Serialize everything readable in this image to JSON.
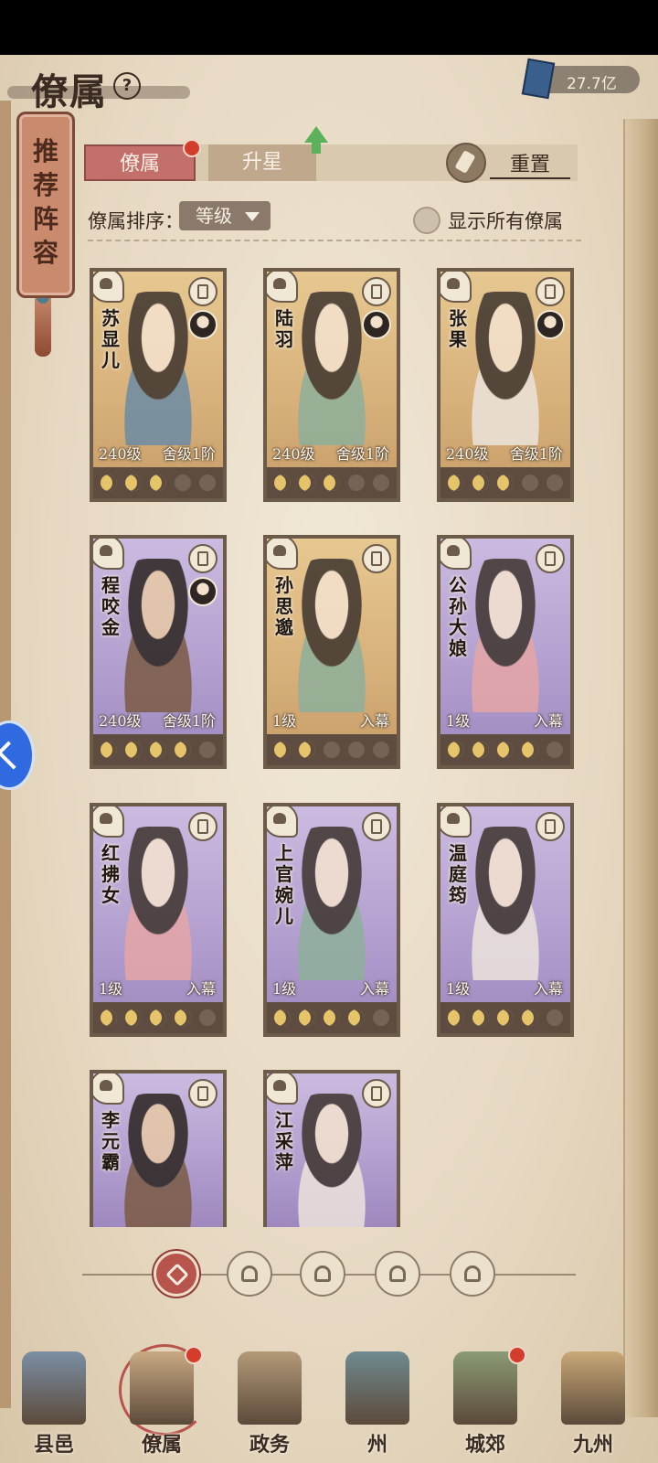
{
  "header": {
    "title": "僚属",
    "help_symbol": "?",
    "currency_value": "27.7亿",
    "currency_icon": "book-currency-icon"
  },
  "recommend_banner": "推荐阵容",
  "tabs": [
    {
      "label": "僚属",
      "active": true,
      "badge": true
    },
    {
      "label": "升星",
      "active": false,
      "badge": false
    }
  ],
  "reset_label": "重置",
  "sort": {
    "label": "僚属排序：",
    "value": "等级"
  },
  "show_all_label": "显示所有僚属",
  "heroes": [
    {
      "name": "苏显儿",
      "level": "240级",
      "rank": "舍级1阶",
      "tier": "gold",
      "moons_full": 3,
      "outfit": "blue"
    },
    {
      "name": "陆羽",
      "level": "240级",
      "rank": "舍级1阶",
      "tier": "gold",
      "moons_full": 3,
      "outfit": "green"
    },
    {
      "name": "张果",
      "level": "240级",
      "rank": "舍级1阶",
      "tier": "gold",
      "moons_full": 3,
      "outfit": "white"
    },
    {
      "name": "程咬金",
      "level": "240级",
      "rank": "舍级1阶",
      "tier": "purple",
      "moons_full": 4,
      "outfit": "dark"
    },
    {
      "name": "孙思邈",
      "level": "1级",
      "rank": "入幕",
      "tier": "gold",
      "moons_full": 2,
      "outfit": "green"
    },
    {
      "name": "公孙大娘",
      "level": "1级",
      "rank": "入幕",
      "tier": "purple",
      "moons_full": 4,
      "outfit": "red"
    },
    {
      "name": "红拂女",
      "level": "1级",
      "rank": "入幕",
      "tier": "purple",
      "moons_full": 4,
      "outfit": "red"
    },
    {
      "name": "上官婉儿",
      "level": "1级",
      "rank": "入幕",
      "tier": "purple",
      "moons_full": 4,
      "outfit": "green"
    },
    {
      "name": "温庭筠",
      "level": "1级",
      "rank": "入幕",
      "tier": "purple",
      "moons_full": 4,
      "outfit": "white"
    },
    {
      "name": "李元霸",
      "level": "",
      "rank": "",
      "tier": "purple",
      "moons_full": 0,
      "outfit": "dark"
    },
    {
      "name": "江采萍",
      "level": "",
      "rank": "",
      "tier": "purple",
      "moons_full": 0,
      "outfit": "white"
    }
  ],
  "filters": [
    {
      "icon": "all-filter-icon",
      "active": true
    },
    {
      "icon": "helmet-filter-icon",
      "active": false
    },
    {
      "icon": "gourd-filter-icon",
      "active": false
    },
    {
      "icon": "fan-filter-icon",
      "active": false
    },
    {
      "icon": "lion-filter-icon",
      "active": false
    }
  ],
  "nav": [
    {
      "label": "县邑",
      "badge": false,
      "active": false,
      "color": "#7b8fa4"
    },
    {
      "label": "僚属",
      "badge": true,
      "active": true,
      "color": "#c8a982"
    },
    {
      "label": "政务",
      "badge": false,
      "active": false,
      "color": "#b39a78"
    },
    {
      "label": "州",
      "badge": false,
      "active": false,
      "color": "#6f8a8f"
    },
    {
      "label": "城郊",
      "badge": true,
      "active": false,
      "color": "#8a9b74"
    },
    {
      "label": "九州",
      "badge": false,
      "active": false,
      "color": "#c9a878"
    }
  ],
  "colors": {
    "active_tab": "#c4706a",
    "gold_card": "#d8b17b",
    "purple_card": "#b3a0cf",
    "badge_red": "#d43c2c"
  }
}
